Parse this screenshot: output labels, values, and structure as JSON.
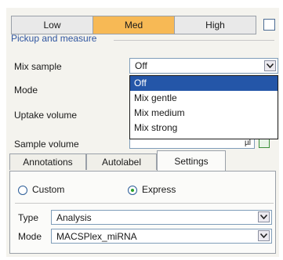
{
  "mode_selector": {
    "options": [
      "Low",
      "Med",
      "High"
    ],
    "selected": "Med"
  },
  "pickup": {
    "group_title": "Pickup and measure",
    "mix_sample_label": "Mix sample",
    "mix_sample_value": "Off",
    "mode_label": "Mode",
    "uptake_volume_label": "Uptake volume",
    "sample_volume_label": "Sample volume",
    "sample_volume_unit": "µl",
    "dropdown_options": [
      "Off",
      "Mix gentle",
      "Mix medium",
      "Mix strong"
    ],
    "dropdown_selected": "Off"
  },
  "tabs": {
    "items": [
      "Annotations",
      "Autolabel",
      "Settings"
    ],
    "active": "Settings"
  },
  "settings": {
    "custom_label": "Custom",
    "express_label": "Express",
    "selected_radio": "Express",
    "type_label": "Type",
    "type_value": "Analysis",
    "mode_label": "Mode",
    "mode_value": "MACSPlex_miRNA"
  },
  "colors": {
    "active_segment": "#f7b955",
    "selection": "#2456a8",
    "group_title": "#2f55a0"
  },
  "icons": {
    "combo_arrow": "chevron-down-icon",
    "radio_dot": "radio-dot-icon"
  }
}
